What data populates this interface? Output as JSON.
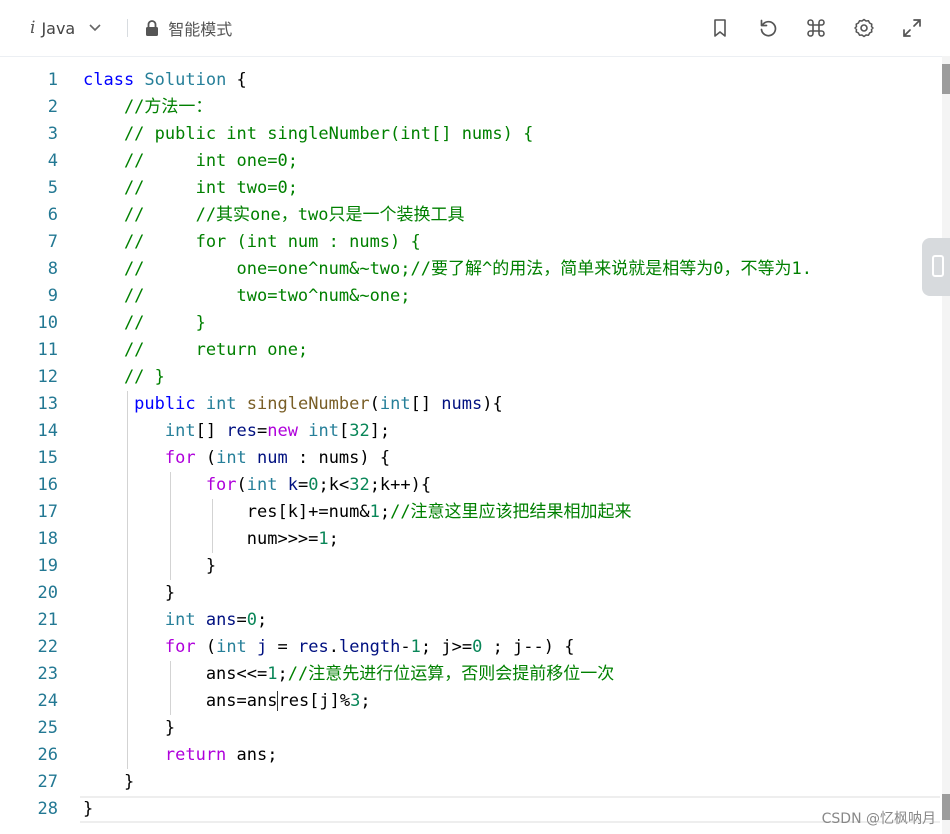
{
  "toolbar": {
    "lang_icon": "i",
    "language": "Java",
    "mode": "智能模式",
    "icons": [
      "bookmark-icon",
      "reset-icon",
      "command-icon",
      "gear-icon",
      "expand-icon"
    ]
  },
  "editor": {
    "lines": [
      {
        "n": "1",
        "tokens": [
          {
            "t": "class ",
            "c": "kw"
          },
          {
            "t": "Solution ",
            "c": "ty"
          },
          {
            "t": "{",
            "c": ""
          }
        ]
      },
      {
        "n": "2",
        "tokens": [
          {
            "t": "    //方法一：",
            "c": "cm"
          }
        ]
      },
      {
        "n": "3",
        "tokens": [
          {
            "t": "    // public int singleNumber(int[] nums) {",
            "c": "cm"
          }
        ]
      },
      {
        "n": "4",
        "tokens": [
          {
            "t": "    //     int one=0;",
            "c": "cm"
          }
        ]
      },
      {
        "n": "5",
        "tokens": [
          {
            "t": "    //     int two=0;",
            "c": "cm"
          }
        ]
      },
      {
        "n": "6",
        "tokens": [
          {
            "t": "    //     //其实one，two只是一个装换工具",
            "c": "cm"
          }
        ]
      },
      {
        "n": "7",
        "tokens": [
          {
            "t": "    //     for (int num : nums) {",
            "c": "cm"
          }
        ]
      },
      {
        "n": "8",
        "tokens": [
          {
            "t": "    //         one=one^num&~two;//要了解^的用法，简单来说就是相等为0，不等为1.",
            "c": "cm"
          }
        ]
      },
      {
        "n": "9",
        "tokens": [
          {
            "t": "    //         two=two^num&~one;",
            "c": "cm"
          }
        ]
      },
      {
        "n": "10",
        "tokens": [
          {
            "t": "    //     }",
            "c": "cm"
          }
        ]
      },
      {
        "n": "11",
        "tokens": [
          {
            "t": "    //     return one;",
            "c": "cm"
          }
        ]
      },
      {
        "n": "12",
        "tokens": [
          {
            "t": "    // }",
            "c": "cm"
          }
        ]
      },
      {
        "n": "13",
        "tokens": [
          {
            "t": "     public ",
            "c": "kw"
          },
          {
            "t": "int ",
            "c": "ty"
          },
          {
            "t": "singleNumber",
            "c": "fn"
          },
          {
            "t": "(",
            "c": ""
          },
          {
            "t": "int",
            "c": "ty"
          },
          {
            "t": "[] ",
            "c": ""
          },
          {
            "t": "nums",
            "c": "vr"
          },
          {
            "t": "){",
            "c": ""
          }
        ]
      },
      {
        "n": "14",
        "tokens": [
          {
            "t": "        int",
            "c": "ty"
          },
          {
            "t": "[] ",
            "c": ""
          },
          {
            "t": "res",
            "c": "vr"
          },
          {
            "t": "=",
            "c": ""
          },
          {
            "t": "new ",
            "c": "kc"
          },
          {
            "t": "int",
            "c": "ty"
          },
          {
            "t": "[",
            "c": ""
          },
          {
            "t": "32",
            "c": "nm"
          },
          {
            "t": "];",
            "c": ""
          }
        ]
      },
      {
        "n": "15",
        "tokens": [
          {
            "t": "        for ",
            "c": "kc"
          },
          {
            "t": "(",
            "c": ""
          },
          {
            "t": "int ",
            "c": "ty"
          },
          {
            "t": "num ",
            "c": "vr"
          },
          {
            "t": ": nums) {",
            "c": ""
          }
        ]
      },
      {
        "n": "16",
        "tokens": [
          {
            "t": "            for",
            "c": "kc"
          },
          {
            "t": "(",
            "c": ""
          },
          {
            "t": "int ",
            "c": "ty"
          },
          {
            "t": "k",
            "c": "vr"
          },
          {
            "t": "=",
            "c": ""
          },
          {
            "t": "0",
            "c": "nm"
          },
          {
            "t": ";k<",
            "c": ""
          },
          {
            "t": "32",
            "c": "nm"
          },
          {
            "t": ";k++){",
            "c": ""
          }
        ]
      },
      {
        "n": "17",
        "tokens": [
          {
            "t": "                res[k]+=num&",
            "c": ""
          },
          {
            "t": "1",
            "c": "nm"
          },
          {
            "t": ";",
            "c": ""
          },
          {
            "t": "//注意这里应该把结果相加起来",
            "c": "cm"
          }
        ]
      },
      {
        "n": "18",
        "tokens": [
          {
            "t": "                num>>>=",
            "c": ""
          },
          {
            "t": "1",
            "c": "nm"
          },
          {
            "t": ";",
            "c": ""
          }
        ]
      },
      {
        "n": "19",
        "tokens": [
          {
            "t": "            }",
            "c": ""
          }
        ]
      },
      {
        "n": "20",
        "tokens": [
          {
            "t": "        }",
            "c": ""
          }
        ]
      },
      {
        "n": "21",
        "tokens": [
          {
            "t": "        int ",
            "c": "ty"
          },
          {
            "t": "ans",
            "c": "vr"
          },
          {
            "t": "=",
            "c": ""
          },
          {
            "t": "0",
            "c": "nm"
          },
          {
            "t": ";",
            "c": ""
          }
        ]
      },
      {
        "n": "22",
        "tokens": [
          {
            "t": "        for ",
            "c": "kc"
          },
          {
            "t": "(",
            "c": ""
          },
          {
            "t": "int ",
            "c": "ty"
          },
          {
            "t": "j ",
            "c": "vr"
          },
          {
            "t": "= ",
            "c": ""
          },
          {
            "t": "res",
            "c": "vr"
          },
          {
            "t": ".",
            "c": ""
          },
          {
            "t": "length",
            "c": "vr"
          },
          {
            "t": "-",
            "c": ""
          },
          {
            "t": "1",
            "c": "nm"
          },
          {
            "t": "; j>=",
            "c": ""
          },
          {
            "t": "0",
            "c": "nm"
          },
          {
            "t": " ; j--) {",
            "c": ""
          }
        ]
      },
      {
        "n": "23",
        "tokens": [
          {
            "t": "            ans<<=",
            "c": ""
          },
          {
            "t": "1",
            "c": "nm"
          },
          {
            "t": ";",
            "c": ""
          },
          {
            "t": "//注意先进行位运算，否则会提前移位一次",
            "c": "cm"
          }
        ]
      },
      {
        "n": "24",
        "tokens": [
          {
            "t": "            ans=ans",
            "c": ""
          },
          {
            "t": "|",
            "c": "cursor"
          },
          {
            "t": "res[j]%",
            "c": ""
          },
          {
            "t": "3",
            "c": "nm"
          },
          {
            "t": ";",
            "c": ""
          }
        ]
      },
      {
        "n": "25",
        "tokens": [
          {
            "t": "        }",
            "c": ""
          }
        ]
      },
      {
        "n": "26",
        "tokens": [
          {
            "t": "        return ",
            "c": "kc"
          },
          {
            "t": "ans;",
            "c": ""
          }
        ]
      },
      {
        "n": "27",
        "tokens": [
          {
            "t": "    }",
            "c": ""
          }
        ]
      },
      {
        "n": "28",
        "tokens": [
          {
            "t": "}",
            "c": ""
          }
        ]
      }
    ]
  },
  "watermark": "CSDN @忆枫呐月"
}
